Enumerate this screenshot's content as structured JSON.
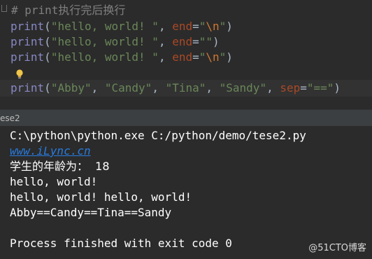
{
  "editor": {
    "comment": "# print执行完后换行",
    "lines": [
      {
        "func": "print",
        "open": "(",
        "str1": "\"hello, world! \"",
        "comma": ", ",
        "param": "end",
        "eq": "=",
        "str2_open": "\"",
        "esc": "\\n",
        "str2_close": "\"",
        "close": ")"
      },
      {
        "func": "print",
        "open": "(",
        "str1": "\"hello, world! \"",
        "comma": ", ",
        "param": "end",
        "eq": "=",
        "str2": "\"\"",
        "close": ")"
      },
      {
        "func": "print",
        "open": "(",
        "str1": "\"hello, world! \"",
        "comma": ", ",
        "param": "end",
        "eq": "=",
        "str2_open": "\"",
        "esc": "\\n",
        "str2_close": "\"",
        "close": ")"
      }
    ],
    "active": {
      "func": "print",
      "open": "(",
      "s1": "\"Abby\"",
      "c1": ", ",
      "s2": "\"Candy\"",
      "c2": ", ",
      "s3": "\"Tina\"",
      "c3": ", ",
      "s4": "\"Sandy\"",
      "c4": ", ",
      "param": "sep",
      "eq": "=",
      "s5": "\"==\"",
      "close": ")"
    }
  },
  "run_panel": {
    "tab_label": "ese2"
  },
  "console": {
    "lines": [
      "C:\\python\\python.exe C:/python/demo/tese2.py",
      "www.iLync.cn",
      "学生的年龄为：  18",
      "hello, world!",
      "hello, world! hello, world!",
      "Abby==Candy==Tina==Sandy",
      "",
      "Process finished with exit code 0"
    ]
  },
  "watermark": {
    "text": "@51CTO博客"
  },
  "colors": {
    "background": "#2b2b2b",
    "keyword_builtin": "#8888c6",
    "string": "#6a8759",
    "escape": "#cc7832",
    "param": "#aa4926",
    "comment": "#808080",
    "link": "#287bde"
  }
}
